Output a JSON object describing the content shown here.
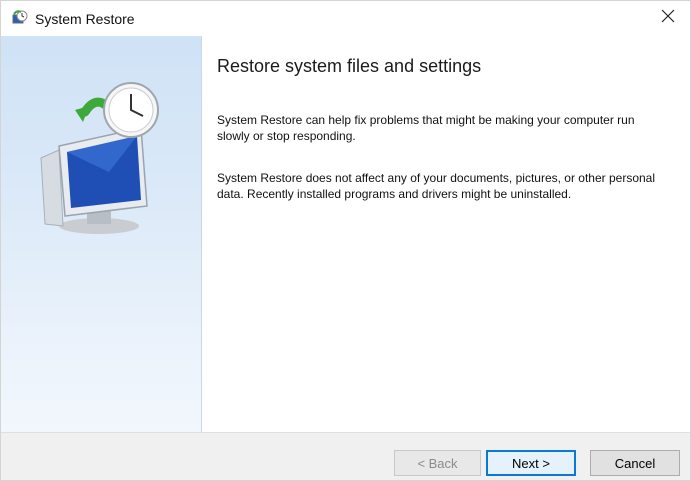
{
  "window": {
    "title": "System Restore",
    "close_glyph": "close-icon"
  },
  "content": {
    "heading": "Restore system files and settings",
    "paragraph1": "System Restore can help fix problems that might be making your computer run slowly or stop responding.",
    "paragraph2": "System Restore does not affect any of your documents, pictures, or other personal data. Recently installed programs and drivers might be uninstalled."
  },
  "buttons": {
    "back": "< Back",
    "next": "Next >",
    "cancel": "Cancel"
  },
  "icons": {
    "app": "system-restore-icon",
    "hero": "system-restore-illustration"
  },
  "colors": {
    "accent": "#0a78d7",
    "sidepanel_top": "#cfe2f6",
    "footer": "#f0f0f0"
  }
}
